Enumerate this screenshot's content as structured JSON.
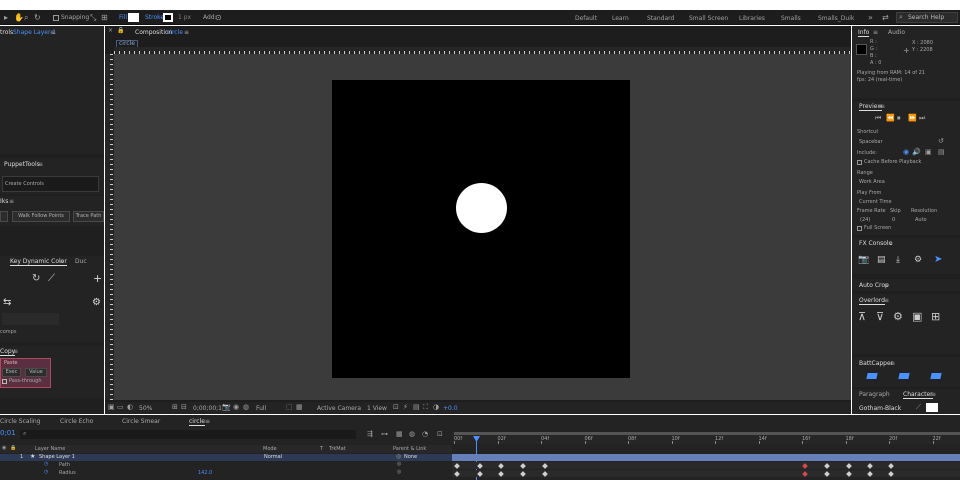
{
  "toolbar": {
    "snapping": "Snapping",
    "fill": "Fill",
    "stroke": "Stroke",
    "stroke_width": "1 px",
    "add": "Add:",
    "search_placeholder": "Search Help"
  },
  "workspaces": [
    "Default",
    "Learn",
    "Standard",
    "Small Screen",
    "Libraries",
    "Smalls",
    "Smalls_Duik"
  ],
  "active_workspace": "Smalls",
  "left_panels": {
    "effect_controls_tab": "trols",
    "effect_controls_layer": "Shape Layer 1",
    "puppet_tools_title": "PuppetTools",
    "create_controls": "Create Controls",
    "duik_title": "Iks",
    "walk_follow_points": "Walk Follow Points",
    "trace_path": "Trace Path",
    "dynamic_color_title": "Key Dynamic Color",
    "dynamic_color_tab2": "Duc",
    "comps_label": "comps",
    "copy_title": "Copy",
    "paste_label": "Paste",
    "button_exec": "Exec",
    "button_values": "Value",
    "pass_through": "Pass-through"
  },
  "composition": {
    "panel_title": "Composition",
    "comp_name": "circle",
    "tab_label": "circle",
    "zoom": "50%",
    "timecode": "0;00;00;14",
    "resolution": "Full",
    "camera": "Active Camera",
    "views": "1 View",
    "exposure": "+0.0"
  },
  "info_panel": {
    "tab_info": "Info",
    "tab_audio": "Audio",
    "r": "R :",
    "g": "G :",
    "b": "B :",
    "a": "A : 0",
    "x": "X : 2080",
    "y": "Y : 2208",
    "status_line1": "Playing from RAM: 14 of 21",
    "status_line2": "fps: 24 (real-time)"
  },
  "preview_panel": {
    "title": "Preview",
    "shortcut_label": "Shortcut",
    "shortcut_value": "Spacebar",
    "include_label": "Include:",
    "cache_label": "Cache Before Playback",
    "range_label": "Range",
    "range_value": "Work Area",
    "play_from_label": "Play From",
    "play_from_value": "Current Time",
    "frame_rate_label": "Frame Rate",
    "skip_label": "Skip",
    "resolution_label": "Resolution",
    "frame_rate_value": "(24)",
    "skip_value": "0",
    "resolution_value": "Auto",
    "full_screen": "Full Screen"
  },
  "right_panels": {
    "fx_console": "FX Console",
    "auto_crop": "Auto Crop",
    "overlord": "Overlord",
    "bartcapper": "BattCapper",
    "paragraph": "Paragraph",
    "character": "Character",
    "font": "Gotham-Black"
  },
  "timeline": {
    "tabs": [
      "Circle Scaling",
      "Circle Echo",
      "Circle Smear",
      "circle"
    ],
    "active_tab": "circle",
    "timecode": "0;01",
    "search_placeholder": "",
    "col_layer_name": "Layer Name",
    "col_mode": "Mode",
    "col_t": "T",
    "col_trkmat": "TrkMat",
    "col_parent": "Parent & Link",
    "layer_index": "1",
    "layer_name": "Shape Layer 1",
    "layer_mode": "Normal",
    "layer_parent": "None",
    "prop_path": "Path",
    "prop_radius": "Radius",
    "radius_value": "142.0",
    "ruler_ticks": [
      "00f",
      "02f",
      "04f",
      "06f",
      "08f",
      "10f",
      "12f",
      "14f",
      "16f",
      "18f",
      "20f",
      "22f"
    ]
  },
  "colors": {
    "accent": "#4c90ff",
    "panel_bg": "#232323",
    "viewer_bg": "#3b3b3b",
    "keyframe_red": "#d24a4a",
    "copy_panel_border": "#b0485e"
  }
}
